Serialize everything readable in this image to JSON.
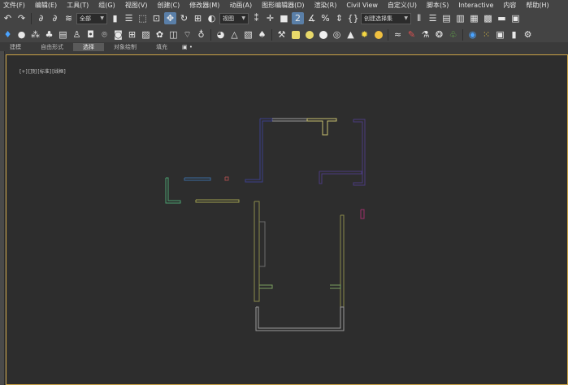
{
  "menubar": {
    "items": [
      "文件(F)",
      "编辑(E)",
      "工具(T)",
      "组(G)",
      "视图(V)",
      "创建(C)",
      "修改器(M)",
      "动画(A)",
      "图形编辑器(D)",
      "渲染(R)",
      "Civil View",
      "自定义(U)",
      "脚本(S)",
      "Interactive",
      "内容",
      "帮助(H)"
    ]
  },
  "toolbar": {
    "selection_filter": "全部",
    "reference_coord": "视图",
    "named_selection": "创建选择集"
  },
  "ribbon": {
    "tabs": [
      "建模",
      "自由形式",
      "选择",
      "对象绘制",
      "填充"
    ],
    "active_tab": "选择",
    "pin": "▣ •"
  },
  "viewport": {
    "label_parts": [
      "[+]",
      "[顶]",
      "[标准]",
      "[线框]"
    ]
  },
  "colors": {
    "accent_border": "#c9a145",
    "viewport_bg": "#2d2d2d",
    "ui_bg": "#444444"
  }
}
